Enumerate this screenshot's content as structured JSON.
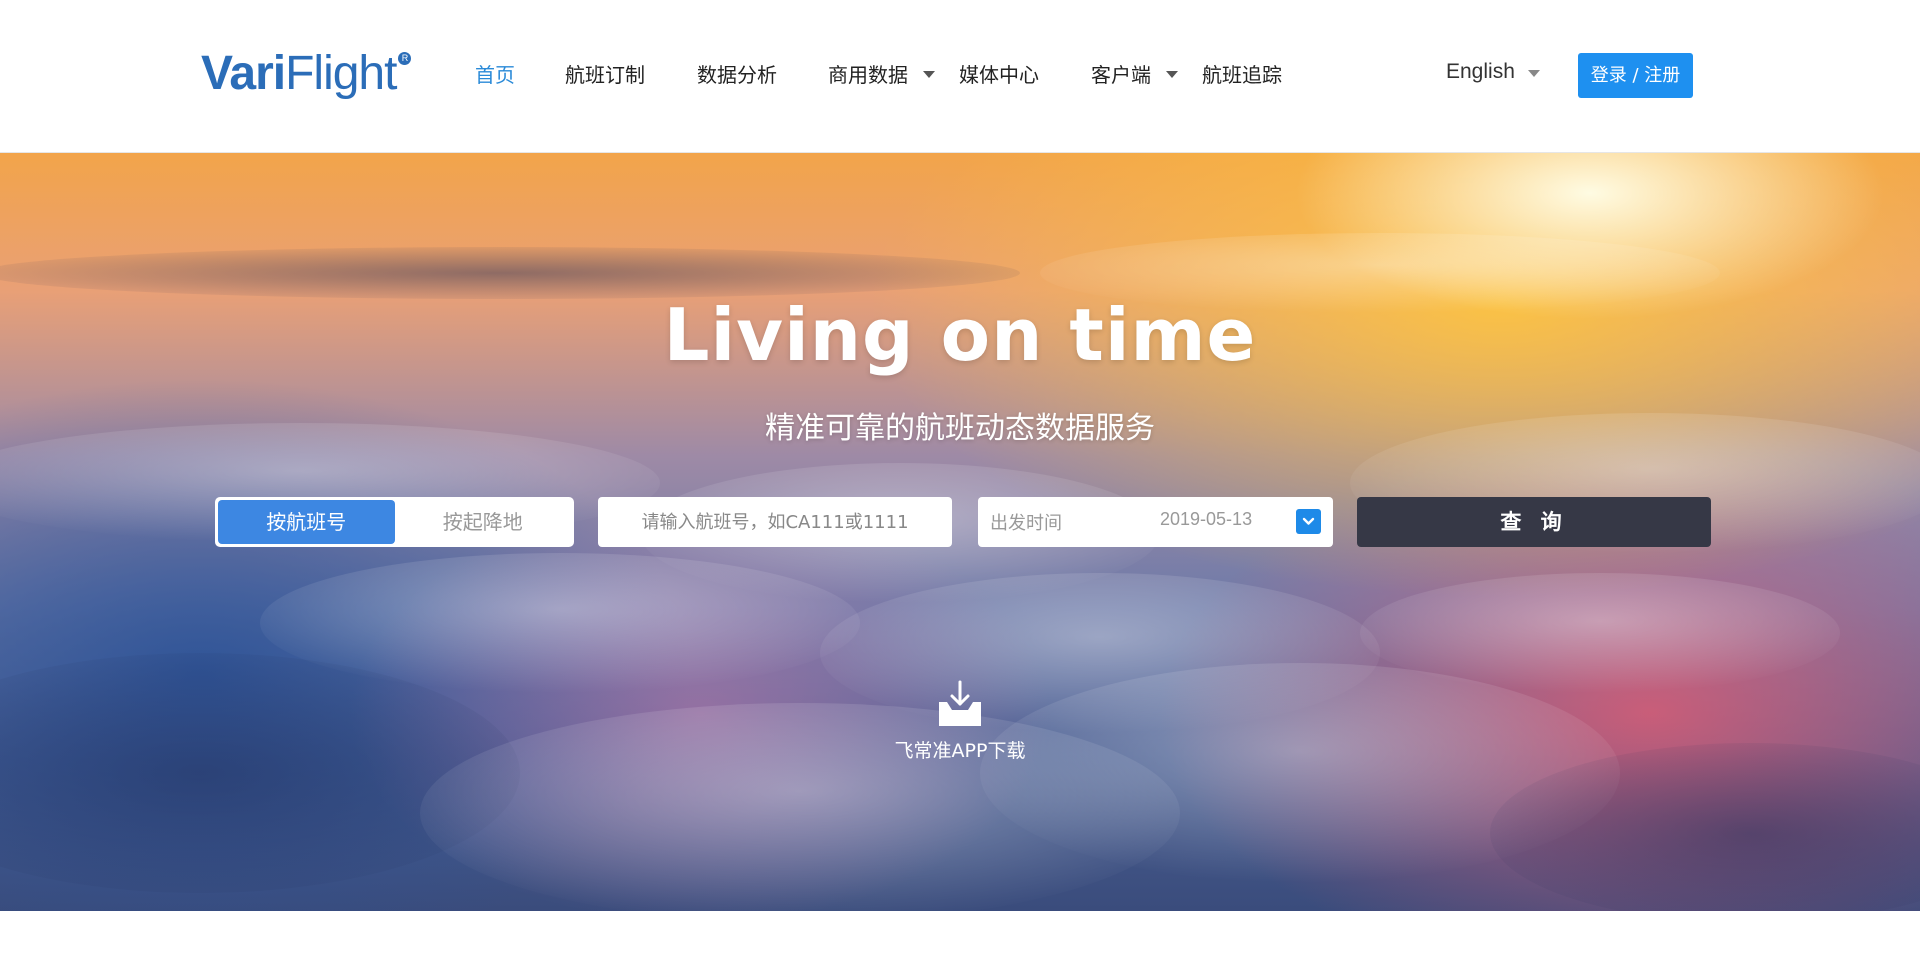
{
  "header": {
    "logo": {
      "part1": "Vari",
      "part2": "Flight",
      "reg": "R"
    },
    "nav": [
      {
        "label": "首页",
        "active": true
      },
      {
        "label": "航班订制"
      },
      {
        "label": "数据分析"
      },
      {
        "label": "商用数据",
        "has_dropdown": true
      },
      {
        "label": "媒体中心"
      },
      {
        "label": "客户端",
        "has_dropdown": true
      },
      {
        "label": "航班追踪"
      }
    ],
    "language": "English",
    "login_label": "登录 / 注册"
  },
  "hero": {
    "title": "Living on time",
    "subtitle": "精准可靠的航班动态数据服务",
    "search": {
      "modes": [
        "按航班号",
        "按起降地"
      ],
      "active_mode": "按航班号",
      "flight_placeholder": "请输入航班号，如CA111或1111",
      "flight_value": "",
      "date_label": "出发时间",
      "date_value": "2019-05-13",
      "submit_label": "查 询"
    },
    "app_download": {
      "label": "飞常准APP下载",
      "icon": "download-tray-icon"
    }
  },
  "colors": {
    "brand": "#2b6db8",
    "active_nav": "#2a8ad8",
    "login_button": "#1e90f0",
    "mode_active": "#3d87e2",
    "search_button": "#363846"
  }
}
